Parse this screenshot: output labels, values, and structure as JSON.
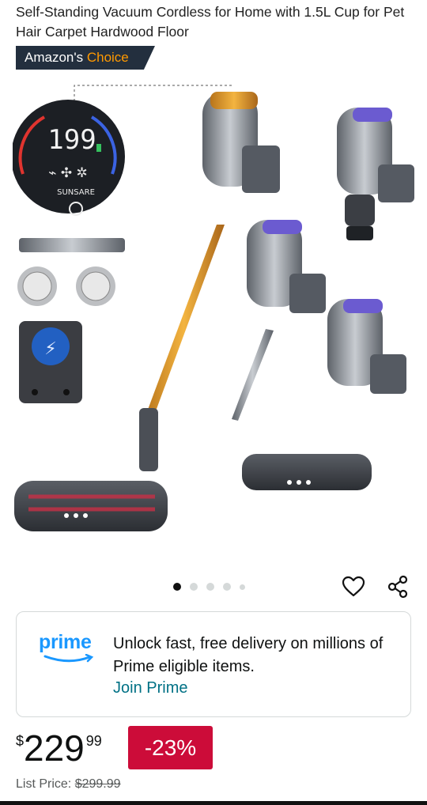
{
  "product": {
    "title": "Self-Standing Vacuum Cordless for Home with 1.5L Cup for Pet Hair Carpet Hardwood Floor"
  },
  "badge": {
    "prefix": "Amazon's",
    "highlight": "Choice"
  },
  "gallery": {
    "display_reading": "199",
    "brand": "SUNSARE",
    "dots_total": 5,
    "active_dot": 1
  },
  "actions": {
    "wishlist_icon": "heart-icon",
    "share_icon": "share-icon"
  },
  "prime": {
    "logo_text": "prime",
    "message": "Unlock fast, free delivery on millions of Prime eligible items.",
    "join_label": "Join Prime"
  },
  "pricing": {
    "currency": "$",
    "whole": "229",
    "fraction": "99",
    "discount": "-23%",
    "list_label": "List Price:",
    "list_value": "$299.99"
  },
  "colors": {
    "amazon_navy": "#232f3e",
    "amazon_orange": "#ff9900",
    "prime_blue": "#1a98ff",
    "link_teal": "#007185",
    "deal_red": "#cc0c39"
  }
}
